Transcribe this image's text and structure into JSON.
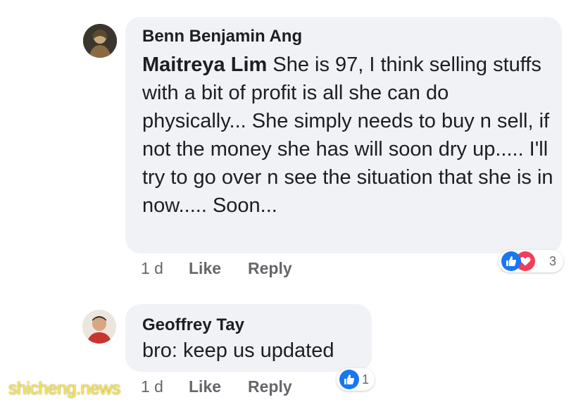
{
  "comments": [
    {
      "author": "Benn Benjamin Ang",
      "mention": "Maitreya Lim",
      "text": " She is 97, I think selling stuffs with a bit of profit is all she can do physically... She simply needs to buy n sell, if not the money she has will soon dry up..... I'll try to go over n see the situation that she is in now..... Soon...",
      "time": "1 d",
      "like_label": "Like",
      "reply_label": "Reply",
      "reactions": [
        "like",
        "love"
      ],
      "reaction_count": "3"
    },
    {
      "author": "Geoffrey Tay",
      "text": "bro: keep us updated",
      "time": "1 d",
      "like_label": "Like",
      "reply_label": "Reply",
      "reactions": [
        "like"
      ],
      "reaction_count": "1"
    }
  ],
  "watermark": "shicheng.news",
  "colors": {
    "like": "#1877f2",
    "love": "#f33e58",
    "bubble": "#f0f2f5",
    "meta": "#65676b"
  }
}
